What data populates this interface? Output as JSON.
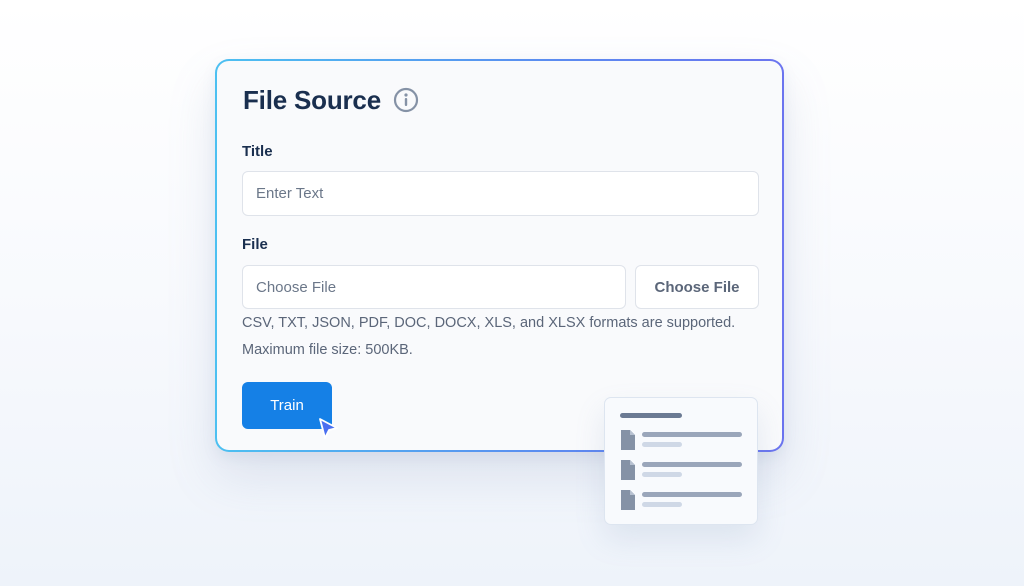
{
  "form": {
    "title": "File Source",
    "title_field": {
      "label": "Title",
      "placeholder": "Enter Text"
    },
    "file_field": {
      "label": "File",
      "placeholder": "Choose File",
      "button_label": "Choose File"
    },
    "help_formats": "CSV, TXT, JSON, PDF, DOC, DOCX, XLS, and XLSX formats are supported.",
    "help_size": "Maximum file size: 500KB.",
    "submit_label": "Train"
  },
  "icons": {
    "info": "info-circle-icon",
    "cursor": "mouse-pointer-icon",
    "file": "document-icon"
  },
  "colors": {
    "accent": "#1580e6",
    "title_text": "#1a2f4f",
    "border_gradient_start": "#4cc0f1",
    "border_gradient_end": "#6b74ef"
  },
  "file_list": {
    "item_count": 3
  }
}
